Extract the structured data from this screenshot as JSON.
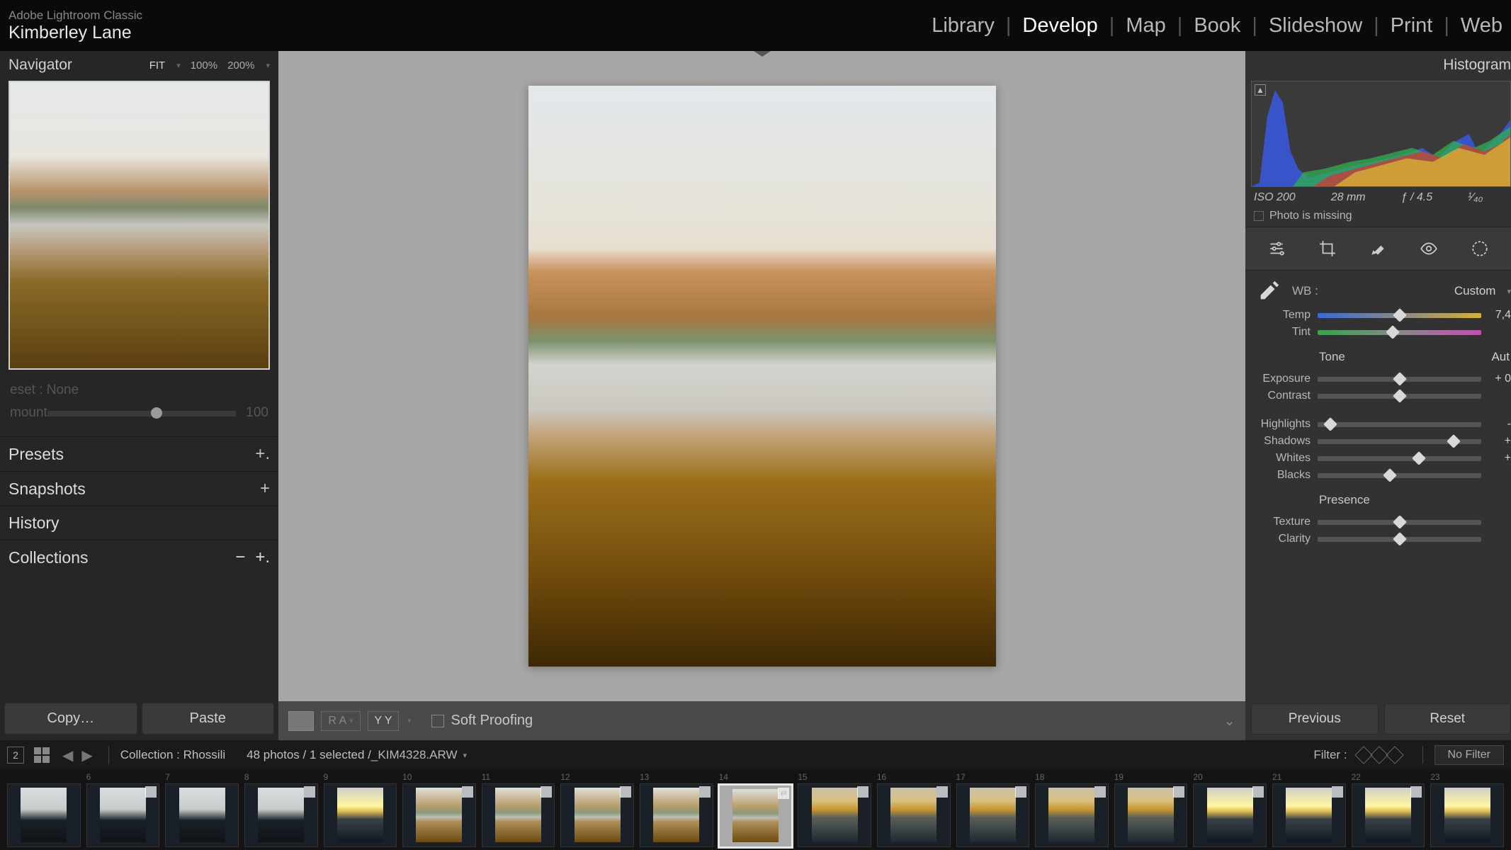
{
  "app": {
    "name": "Adobe Lightroom Classic",
    "user": "Kimberley Lane"
  },
  "modules": [
    "Library",
    "Develop",
    "Map",
    "Book",
    "Slideshow",
    "Print",
    "Web"
  ],
  "active_module": "Develop",
  "navigator": {
    "title": "Navigator",
    "zoom": [
      "FIT",
      "100%",
      "200%"
    ],
    "zoom_active": "FIT"
  },
  "preset": {
    "label": "eset : None",
    "amount_label": "mount",
    "amount_value": "100"
  },
  "left_sections": {
    "presets": "Presets",
    "snapshots": "Snapshots",
    "history": "History",
    "collections": "Collections"
  },
  "copy_paste": {
    "copy": "Copy…",
    "paste": "Paste"
  },
  "toolbar": {
    "soft_proofing": "Soft Proofing",
    "ra": "R A",
    "yy": "Y Y"
  },
  "histogram": {
    "title": "Histogram",
    "iso": "ISO 200",
    "focal": "28 mm",
    "aperture": "ƒ / 4.5",
    "sub": "¹⁄₄₀",
    "missing": "Photo is missing"
  },
  "basic": {
    "wb_label": "WB :",
    "wb_value": "Custom",
    "temp": {
      "label": "Temp",
      "value": "7,4",
      "pos": 50
    },
    "tint": {
      "label": "Tint",
      "value": "",
      "pos": 46
    },
    "tone_header": "Tone",
    "tone_auto": "Aut",
    "exposure": {
      "label": "Exposure",
      "value": "+ 0",
      "pos": 50
    },
    "contrast": {
      "label": "Contrast",
      "value": "",
      "pos": 50
    },
    "highlights": {
      "label": "Highlights",
      "value": "-",
      "pos": 8
    },
    "shadows": {
      "label": "Shadows",
      "value": "+",
      "pos": 83
    },
    "whites": {
      "label": "Whites",
      "value": "+",
      "pos": 62
    },
    "blacks": {
      "label": "Blacks",
      "value": "",
      "pos": 44
    },
    "presence_header": "Presence",
    "texture": {
      "label": "Texture",
      "value": "",
      "pos": 50
    },
    "clarity": {
      "label": "Clarity",
      "value": "",
      "pos": 50
    }
  },
  "prev_reset": {
    "previous": "Previous",
    "reset": "Reset"
  },
  "bottombar": {
    "badge": "2",
    "collection": "Collection : Rhossili",
    "count": "48 photos / 1 selected /",
    "file": "_KIM4328.ARW",
    "filter_label": "Filter :",
    "no_filter": "No Filter"
  },
  "filmstrip": {
    "thumbs": [
      {
        "n": "",
        "style": "a",
        "badge": false
      },
      {
        "n": "6",
        "style": "a",
        "badge": true
      },
      {
        "n": "7",
        "style": "a",
        "badge": false
      },
      {
        "n": "8",
        "style": "a",
        "badge": true
      },
      {
        "n": "9",
        "style": "d",
        "badge": false
      },
      {
        "n": "10",
        "style": "b",
        "badge": true
      },
      {
        "n": "11",
        "style": "b",
        "badge": true
      },
      {
        "n": "12",
        "style": "b",
        "badge": true
      },
      {
        "n": "13",
        "style": "b",
        "badge": true
      },
      {
        "n": "14",
        "style": "b",
        "badge": true,
        "selected": true
      },
      {
        "n": "15",
        "style": "c",
        "badge": true
      },
      {
        "n": "16",
        "style": "c",
        "badge": true
      },
      {
        "n": "17",
        "style": "c",
        "badge": true
      },
      {
        "n": "18",
        "style": "c",
        "badge": true
      },
      {
        "n": "19",
        "style": "c",
        "badge": true
      },
      {
        "n": "20",
        "style": "d",
        "badge": true
      },
      {
        "n": "21",
        "style": "d",
        "badge": true
      },
      {
        "n": "22",
        "style": "d",
        "badge": true
      },
      {
        "n": "23",
        "style": "d",
        "badge": false
      }
    ]
  }
}
